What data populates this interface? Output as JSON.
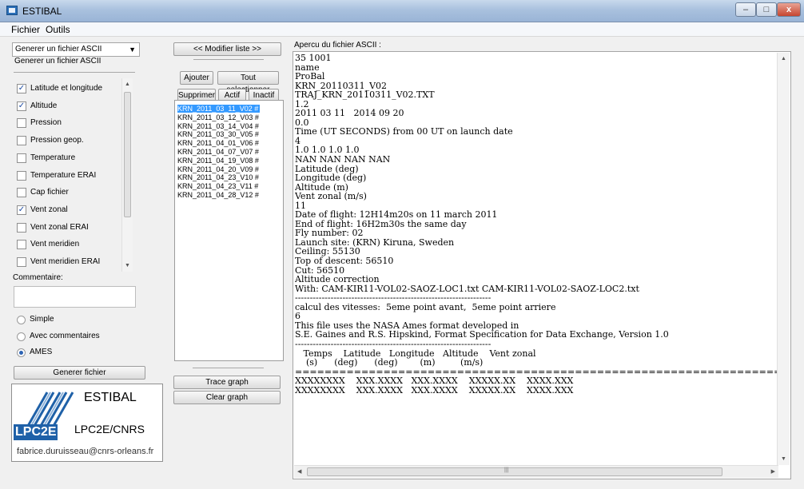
{
  "window": {
    "title": "ESTIBAL",
    "minimize": "–",
    "maximize": "□",
    "close": "x"
  },
  "menu": [
    "Fichier",
    "Outils"
  ],
  "left_panel": {
    "combo_value": "Generer un fichier ASCII",
    "mode_label": "Generer un fichier ASCII",
    "parameters": [
      {
        "label": "Latitude et longitude",
        "checked": true
      },
      {
        "label": "Altitude",
        "checked": true
      },
      {
        "label": "Pression",
        "checked": false
      },
      {
        "label": "Pression geop.",
        "checked": false
      },
      {
        "label": "Temperature",
        "checked": false
      },
      {
        "label": "Temperature ERAI",
        "checked": false
      },
      {
        "label": "Cap fichier",
        "checked": false
      },
      {
        "label": "Vent zonal",
        "checked": true
      },
      {
        "label": "Vent zonal ERAI",
        "checked": false
      },
      {
        "label": "Vent meridien",
        "checked": false
      },
      {
        "label": "Vent meridien ERAI",
        "checked": false
      }
    ],
    "comment_label": "Commentaire:",
    "comment_value": "",
    "format_options": [
      {
        "label": "Simple",
        "selected": false
      },
      {
        "label": "Avec commentaires",
        "selected": false
      },
      {
        "label": "AMES",
        "selected": true
      }
    ],
    "generate_button": "Generer fichier"
  },
  "logo": {
    "name": "ESTIBAL",
    "lab": "LPC2E/CNRS",
    "mark": "LPC2E",
    "email": "fabrice.duruisseau@cnrs-orleans.fr"
  },
  "middle_panel": {
    "modify_button": "<<   Modifier liste   >>",
    "add_button": "Ajouter",
    "select_all_button": "Tout selectionner",
    "delete_button": "Supprimer",
    "active_button": "Actif",
    "inactive_button": "Inactif",
    "files": [
      "KRN_2011_03_11_V02 #",
      "KRN_2011_03_12_V03 #",
      "KRN_2011_03_14_V04 #",
      "KRN_2011_03_30_V05 #",
      "KRN_2011_04_01_V06 #",
      "KRN_2011_04_07_V07 #",
      "KRN_2011_04_19_V08 #",
      "KRN_2011_04_20_V09 #",
      "KRN_2011_04_23_V10 #",
      "KRN_2011_04_23_V11 #",
      "KRN_2011_04_28_V12 #"
    ],
    "selected_index": 0,
    "trace_button": "Trace graph",
    "clear_button": "Clear graph"
  },
  "preview": {
    "label": "Apercu du fichier ASCII :",
    "lines": [
      "35 1001",
      "name",
      "ProBal",
      "KRN_20110311_V02",
      "TRAJ_KRN_20110311_V02.TXT",
      "1.2",
      "2011 03 11   2014 09 20",
      "0.0",
      "Time (UT SECONDS) from 00 UT on launch date",
      "4",
      "1.0 1.0 1.0 1.0",
      "NAN NAN NAN NAN",
      "Latitude (deg)",
      "Longitude (deg)",
      "Altitude (m)",
      "Vent zonal (m/s)",
      "11",
      "Date of flight: 12H14m20s on 11 march 2011",
      "End of flight: 16H2m30s the same day",
      "Fly number: 02",
      "Launch site: (KRN) Kiruna, Sweden",
      "Ceiling: 55130",
      "Top of descent: 56510",
      "Cut: 56510",
      "Altitude correction",
      "With: CAM-KIR11-VOL02-SAOZ-LOC1.txt CAM-KIR11-VOL02-SAOZ-LOC2.txt",
      "------------------------------------------------------------------",
      "calcul des vitesses:  5eme point avant,  5eme point arriere",
      "6",
      "This file uses the NASA Ames format developed in",
      "S.E. Gaines and R.S. Hipskind, Format Specification for Data Exchange, Version 1.0",
      "------------------------------------------------------------------",
      "   Temps    Latitude   Longitude   Altitude    Vent zonal",
      "    (s)      (deg)      (deg)        (m)         (m/s)",
      "==================================================================",
      "XXXXXXXX    XXX.XXXX   XXX.XXXX    XXXXX.XX    XXXX.XXX",
      "XXXXXXXX    XXX.XXXX   XXX.XXXX    XXXXX.XX    XXXX.XXX"
    ]
  }
}
